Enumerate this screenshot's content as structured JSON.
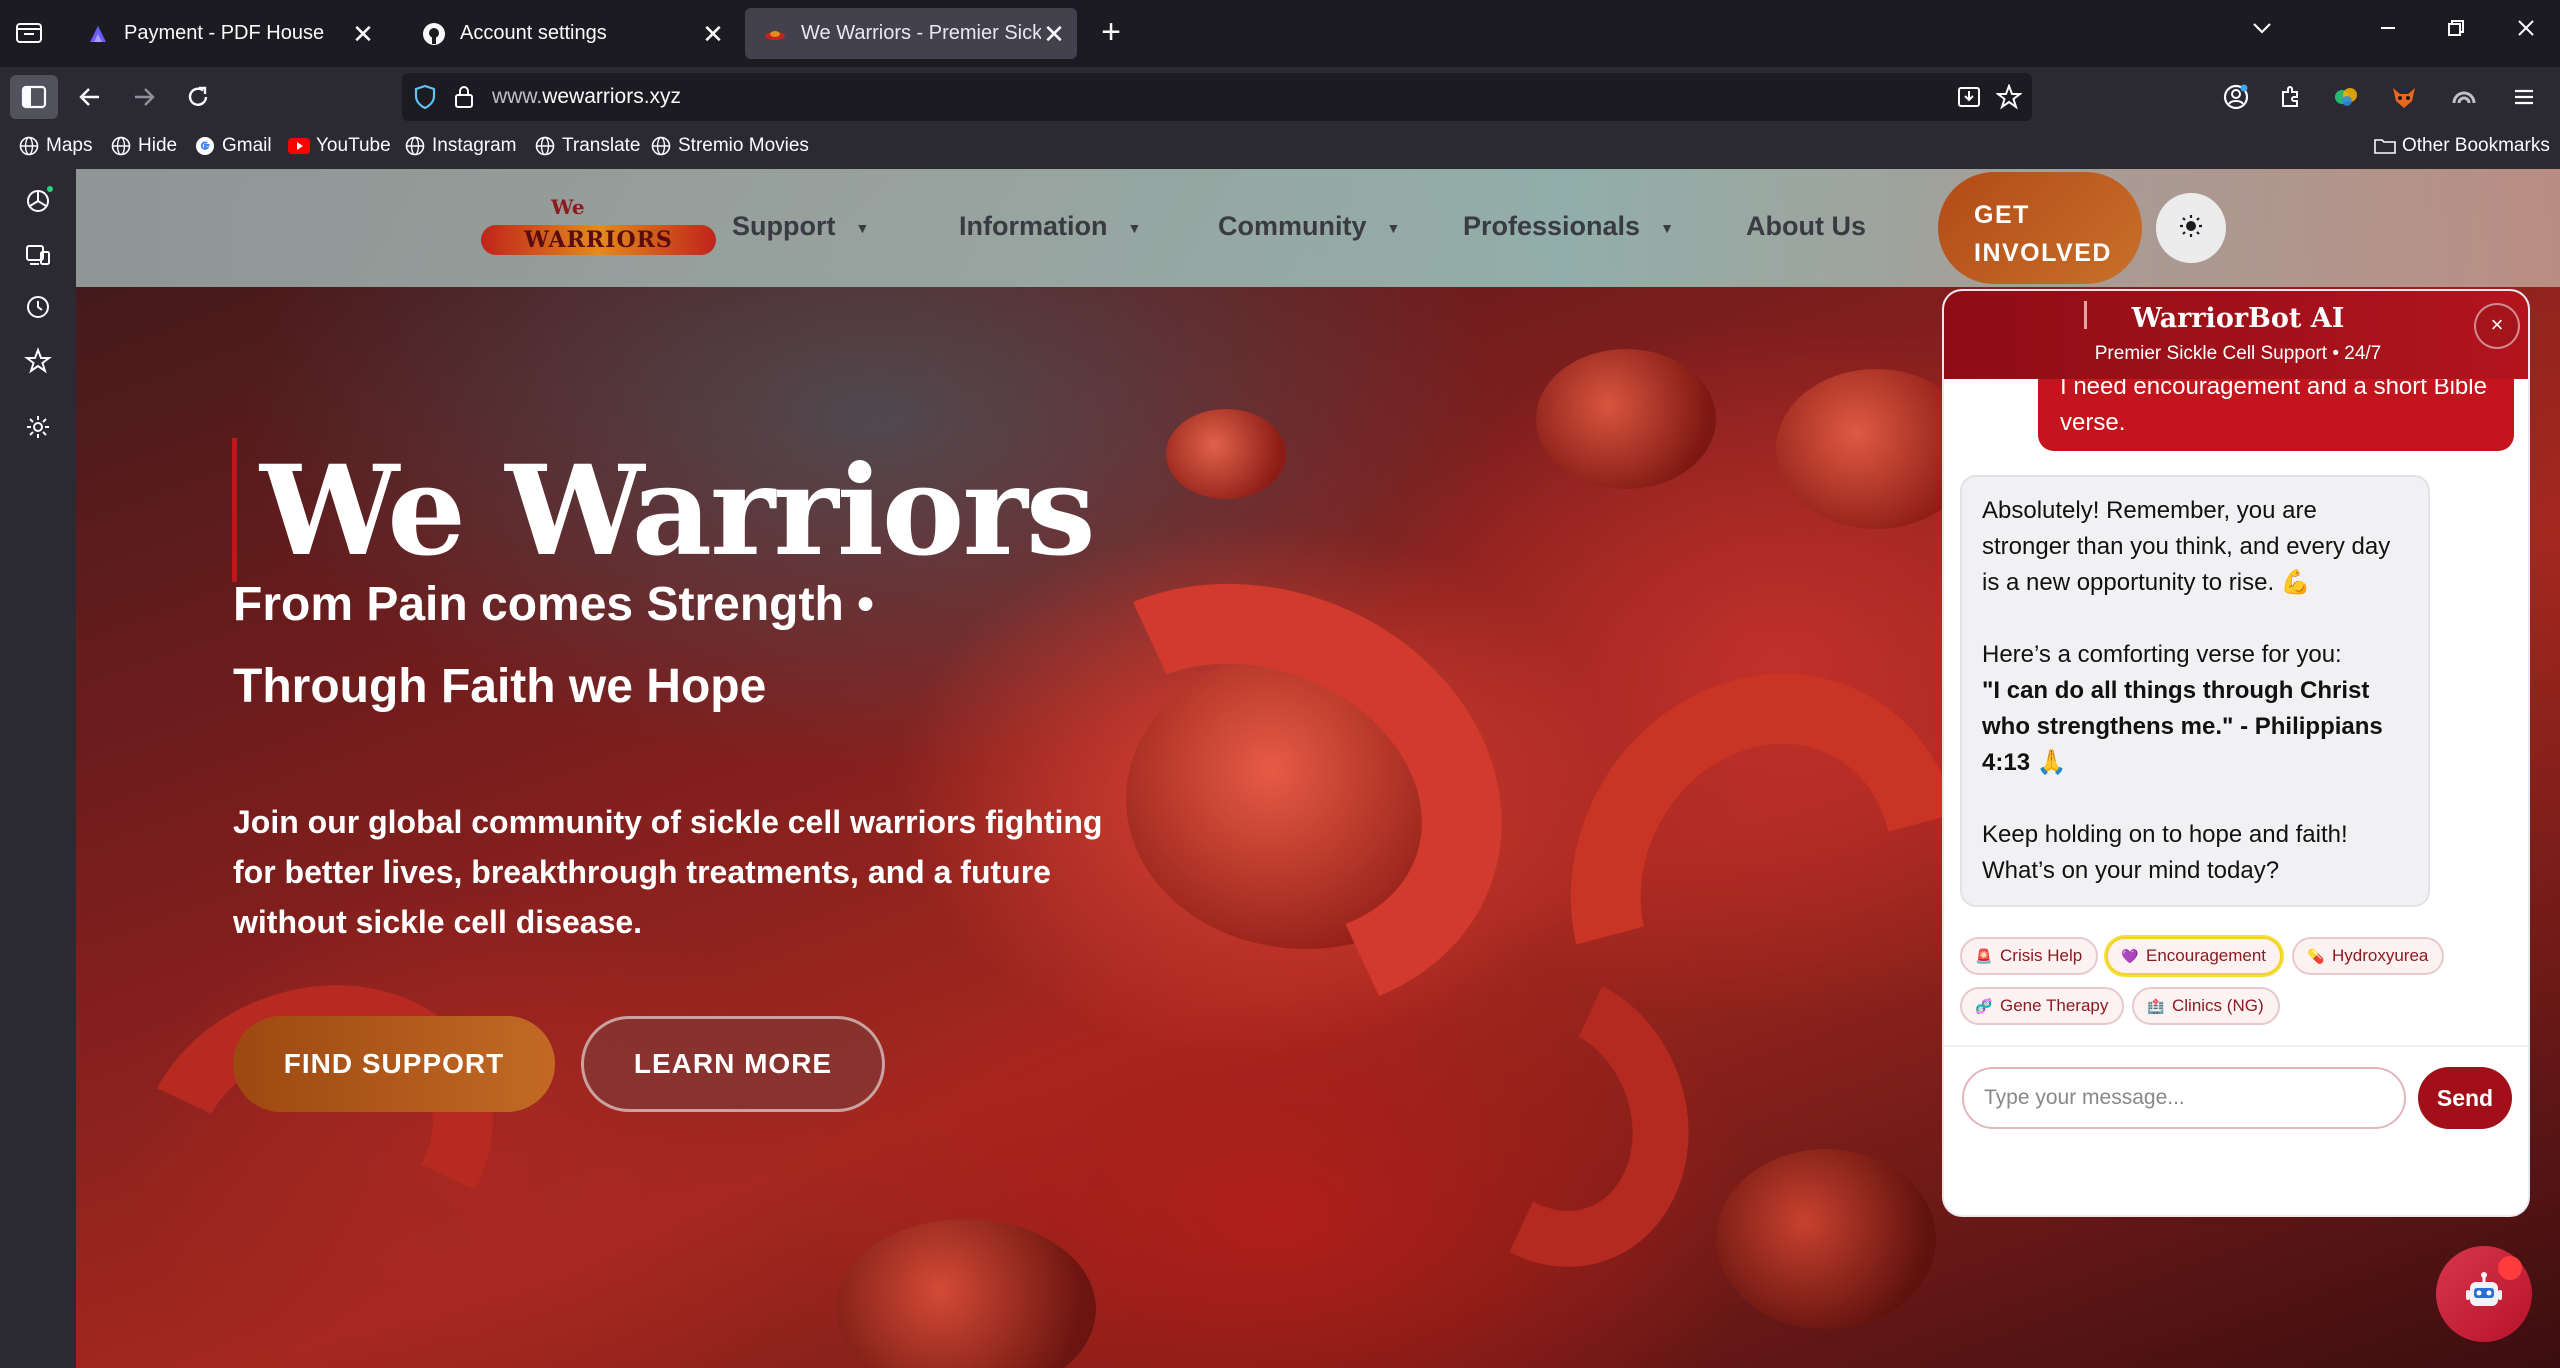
{
  "browser": {
    "tabs": [
      {
        "title": "Payment - PDF House",
        "icon": "pdfhouse-icon",
        "close": "✕"
      },
      {
        "title": "Account settings",
        "icon": "github-icon",
        "close": "✕"
      },
      {
        "title": "We Warriors - Premier Sickle Ce",
        "icon": "wewarriors-icon",
        "close": "✕",
        "active": true
      }
    ],
    "new_tab": "+",
    "url_prefix": "www.",
    "url_domain": "wewarriors.xyz",
    "bookmarks": [
      {
        "label": "Maps",
        "icon": "globe-icon"
      },
      {
        "label": "Hide",
        "icon": "globe-icon"
      },
      {
        "label": "Gmail",
        "icon": "google-icon"
      },
      {
        "label": "YouTube",
        "icon": "youtube-icon"
      },
      {
        "label": "Instagram",
        "icon": "globe-icon"
      },
      {
        "label": "Translate",
        "icon": "globe-icon"
      },
      {
        "label": "Stremio Movies",
        "icon": "globe-icon"
      }
    ],
    "other_bookmarks": "Other Bookmarks"
  },
  "site": {
    "logo_we": "We",
    "logo_warriors": "WARRIORS",
    "nav": [
      {
        "label": "Support",
        "caret": "▼"
      },
      {
        "label": "Information",
        "caret": "▼"
      },
      {
        "label": "Community",
        "caret": "▼"
      },
      {
        "label": "Professionals",
        "caret": "▼"
      },
      {
        "label": "About Us",
        "caret": ""
      }
    ],
    "get_involved": "GET INVOLVED",
    "hero": {
      "title": "We Warriors",
      "subtitle": "From Pain comes Strength • Through Faith we Hope",
      "description": "Join our global community of sickle cell warriors fighting for better lives, breakthrough treatments, and a future without sickle cell disease.",
      "find_support": "FIND SUPPORT",
      "learn_more": "LEARN MORE"
    }
  },
  "chat": {
    "title": "WarriorBot AI",
    "subtitle": "Premier Sickle Cell Support • 24/7",
    "close": "×",
    "user_message": "I need encouragement and a short Bible verse.",
    "bot_message": {
      "p1": "Absolutely! Remember, you are stronger than you think, and every day is a new opportunity to rise. 💪",
      "p2": "Here’s a comforting verse for you:",
      "verse": "\"I can do all things through Christ who strengthens me.\" - Philippians 4:13 🙏",
      "p3": "Keep holding on to hope and faith! What’s on your mind today?"
    },
    "chips": [
      {
        "label": "Crisis Help",
        "icon": "🚨"
      },
      {
        "label": "Encouragement",
        "icon": "💜",
        "selected": true
      },
      {
        "label": "Hydroxyurea",
        "icon": "💊"
      },
      {
        "label": "Gene Therapy",
        "icon": "🧬"
      },
      {
        "label": "Clinics (NG)",
        "icon": "🏥"
      }
    ],
    "input_placeholder": "Type your message...",
    "send": "Send"
  },
  "colors": {
    "accent": "#b3141e",
    "get_involved": "#c26a24",
    "chip_selected_ring": "#f2d327"
  }
}
